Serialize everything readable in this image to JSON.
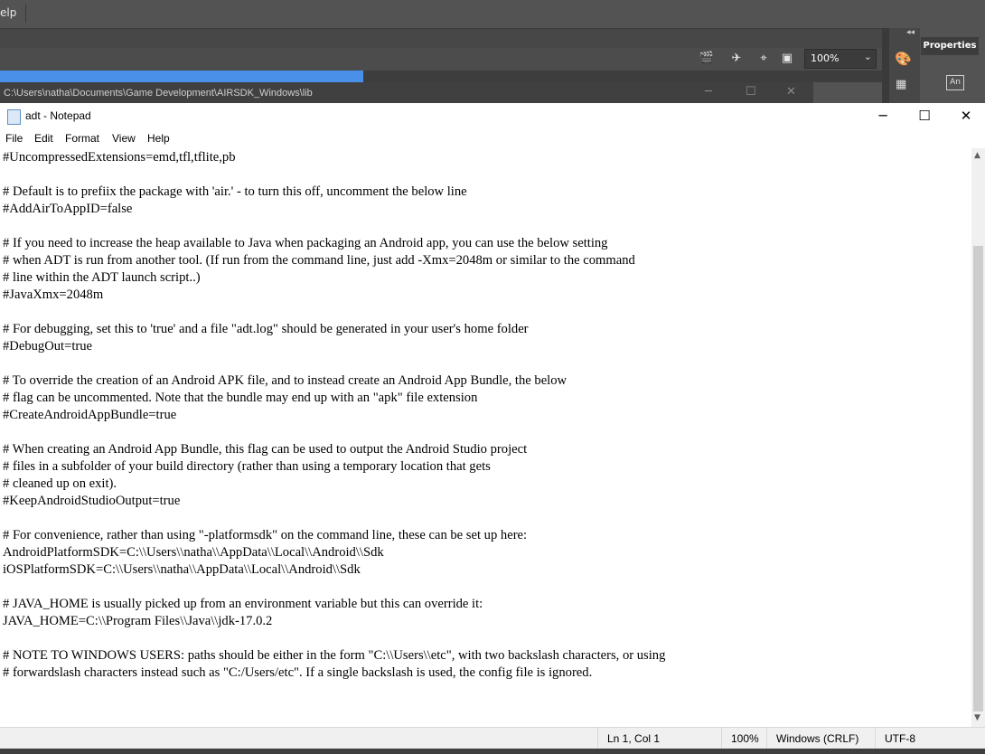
{
  "background_app": {
    "menu_fragment": "elp",
    "zoom": "100%",
    "progress_fraction": 0.412,
    "explorer_path": "C:\\Users\\natha\\Documents\\Game Development\\AIRSDK_Windows\\lib",
    "panel_tab": "Properties",
    "panel_an_label": "An"
  },
  "notepad": {
    "title": "adt - Notepad",
    "menu": [
      "File",
      "Edit",
      "Format",
      "View",
      "Help"
    ],
    "lines": [
      "#UncompressedExtensions=emd,tfl,tflite,pb",
      "",
      "# Default is to prefiix the package with 'air.' - to turn this off, uncomment the below line",
      "#AddAirToAppID=false",
      "",
      "# If you need to increase the heap available to Java when packaging an Android app, you can use the below setting",
      "# when ADT is run from another tool. (If run from the command line, just add -Xmx=2048m or similar to the command",
      "# line within the ADT launch script..)",
      "#JavaXmx=2048m",
      "",
      "# For debugging, set this to 'true' and a file \"adt.log\" should be generated in your user's home folder",
      "#DebugOut=true",
      "",
      "# To override the creation of an Android APK file, and to instead create an Android App Bundle, the below",
      "# flag can be uncommented. Note that the bundle may end up with an \"apk\" file extension",
      "#CreateAndroidAppBundle=true",
      "",
      "# When creating an Android App Bundle, this flag can be used to output the Android Studio project",
      "# files in a subfolder of your build directory (rather than using a temporary location that gets",
      "# cleaned up on exit).",
      "#KeepAndroidStudioOutput=true",
      "",
      "# For convenience, rather than using \"-platformsdk\" on the command line, these can be set up here:",
      "AndroidPlatformSDK=C:\\\\Users\\\\natha\\\\AppData\\\\Local\\\\Android\\\\Sdk",
      "iOSPlatformSDK=C:\\\\Users\\\\natha\\\\AppData\\\\Local\\\\Android\\\\Sdk",
      "",
      "# JAVA_HOME is usually picked up from an environment variable but this can override it:",
      "JAVA_HOME=C:\\\\Program Files\\\\Java\\\\jdk-17.0.2",
      "",
      "# NOTE TO WINDOWS USERS: paths should be either in the form \"C:\\\\Users\\\\etc\", with two backslash characters, or using",
      "# forwardslash characters instead such as \"C:/Users/etc\". If a single backslash is used, the config file is ignored."
    ],
    "status": {
      "position": "Ln 1, Col 1",
      "zoom": "100%",
      "line_endings": "Windows (CRLF)",
      "encoding": "UTF-8"
    }
  }
}
